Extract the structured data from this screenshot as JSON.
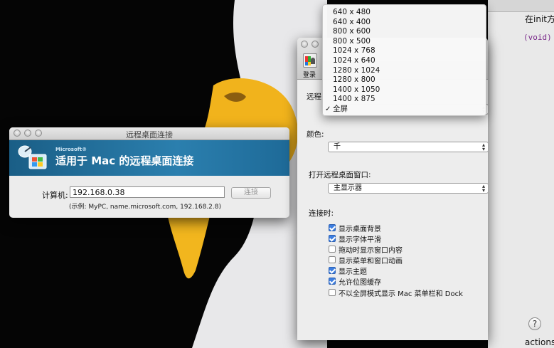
{
  "desktop": {
    "code_line_1": "在init方",
    "code_line_2": "(void)",
    "code_line_3": "actions"
  },
  "rdc_window": {
    "title": "远程桌面连接",
    "brand": "Microsoft®",
    "heading": "适用于 Mac 的远程桌面连接",
    "computer_label": "计算机:",
    "computer_value": "192.168.0.38",
    "connect_label": "连接",
    "hint": "(示例: MyPC, name.microsoft.com, 192.168.2.8)"
  },
  "prefs_window": {
    "toolbar": {
      "login_label": "登录"
    },
    "remote_label": "远程",
    "color_label": "颜色:",
    "color_value": "千",
    "open_label": "打开远程桌面窗口:",
    "open_value": "主显示器",
    "connect_section_label": "连接时:",
    "checkboxes": [
      {
        "label": "显示桌面背景",
        "checked": true
      },
      {
        "label": "显示字体平滑",
        "checked": true
      },
      {
        "label": "拖动时显示窗口内容",
        "checked": false
      },
      {
        "label": "显示菜单和窗口动画",
        "checked": false
      },
      {
        "label": "显示主题",
        "checked": true
      },
      {
        "label": "允许位图缓存",
        "checked": true
      },
      {
        "label": "不以全屏模式显示 Mac 菜单栏和 Dock",
        "checked": false
      }
    ],
    "help_label": "?"
  },
  "resolution_menu": {
    "items": [
      "640 x 480",
      "640 x 400",
      "800 x 600",
      "800 x 500",
      "1024 x 768",
      "1024 x 640",
      "1280 x 1024",
      "1280 x 800",
      "1400 x 1050",
      "1400 x 875",
      "全屏"
    ],
    "selected": "全屏",
    "check_mark": "✓"
  },
  "colors": {
    "banner": "#2b7fae",
    "checkbox_on": "#3d7ee0"
  }
}
